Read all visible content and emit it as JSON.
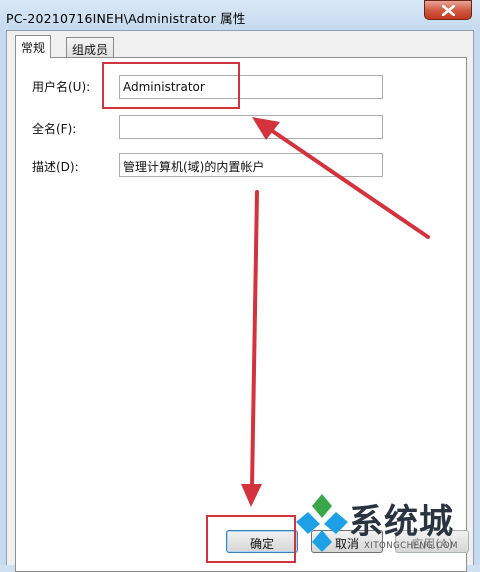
{
  "window": {
    "title": "PC-20210716INEH\\Administrator 属性"
  },
  "tabs": [
    {
      "label": "常规"
    },
    {
      "label": "组成员"
    }
  ],
  "form": {
    "username_label": "用户名(U):",
    "username_value": "Administrator",
    "fullname_label": "全名(F):",
    "fullname_value": "",
    "description_label": "描述(D):",
    "description_value": "管理计算机(域)的内置帐户"
  },
  "buttons": {
    "ok": "确定",
    "cancel": "取消",
    "apply": "应用(A)"
  },
  "watermark": {
    "text": "系统城",
    "subtext": "XITONGCHENG.COM"
  },
  "colors": {
    "annotation_red": "#d2333d",
    "watermark_blue": "#1ea0e6",
    "watermark_green": "#3aa64a"
  }
}
